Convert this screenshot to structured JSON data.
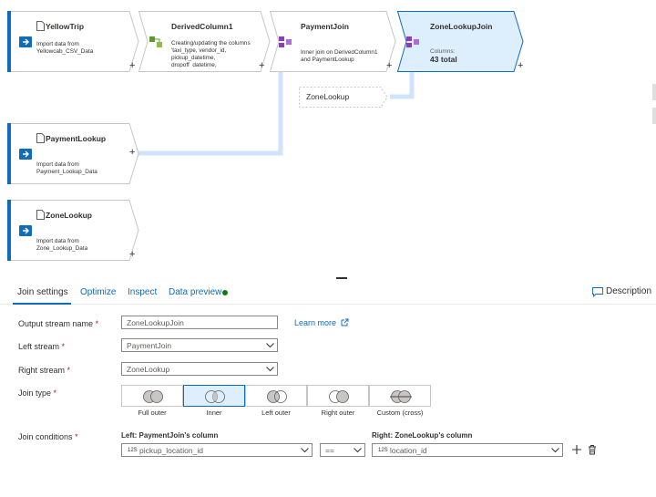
{
  "nodes": {
    "yellowtrip": {
      "title": "YellowTrip",
      "desc": "Import data from Yellowcab_CSV_Data"
    },
    "derived": {
      "title": "DerivedColumn1",
      "desc": "Creating/updating the columns 'taxi_type, vendor_id, pickup_datetime, dropoff_datetime,"
    },
    "paymentjoin": {
      "title": "PaymentJoin",
      "desc": "Inner join on DerivedColumn1 and PaymentLookup"
    },
    "zonejoin": {
      "title": "ZoneLookupJoin",
      "columns_label": "Columns:",
      "columns_total": "43 total"
    },
    "paymentlookup": {
      "title": "PaymentLookup",
      "desc": "Import data from Payment_Lookup_Data"
    },
    "zonelookup": {
      "title": "ZoneLookup",
      "desc": "Import data from Zone_Lookup_Data"
    },
    "zone_ref_label": "ZoneLookup",
    "plus": "+"
  },
  "tabs": {
    "join_settings": "Join settings",
    "optimize": "Optimize",
    "inspect": "Inspect",
    "data_preview": "Data preview",
    "description": "Description"
  },
  "form": {
    "output_label": "Output stream name",
    "output_value": "ZoneLookupJoin",
    "learn_more": "Learn more",
    "left_label": "Left stream",
    "left_value": "PaymentJoin",
    "right_label": "Right stream",
    "right_value": "ZoneLookup",
    "jointype_label": "Join type",
    "join_conditions_label": "Join conditions",
    "required": "*"
  },
  "join_types": [
    "Full outer",
    "Inner",
    "Left outer",
    "Right outer",
    "Custom (cross)"
  ],
  "selected_join_type": "Inner",
  "conditions": {
    "left_header": "Left: PaymentJoin's column",
    "right_header": "Right: ZoneLookup's column",
    "left_type": "12S",
    "left_value": "pickup_location_id",
    "operator": "==",
    "right_type": "12S",
    "right_value": "location_id"
  },
  "colors": {
    "accent": "#0f6cbd",
    "selected_node": "#ddeefc",
    "connector": "#cfe4fa",
    "status_green": "#107c10"
  }
}
